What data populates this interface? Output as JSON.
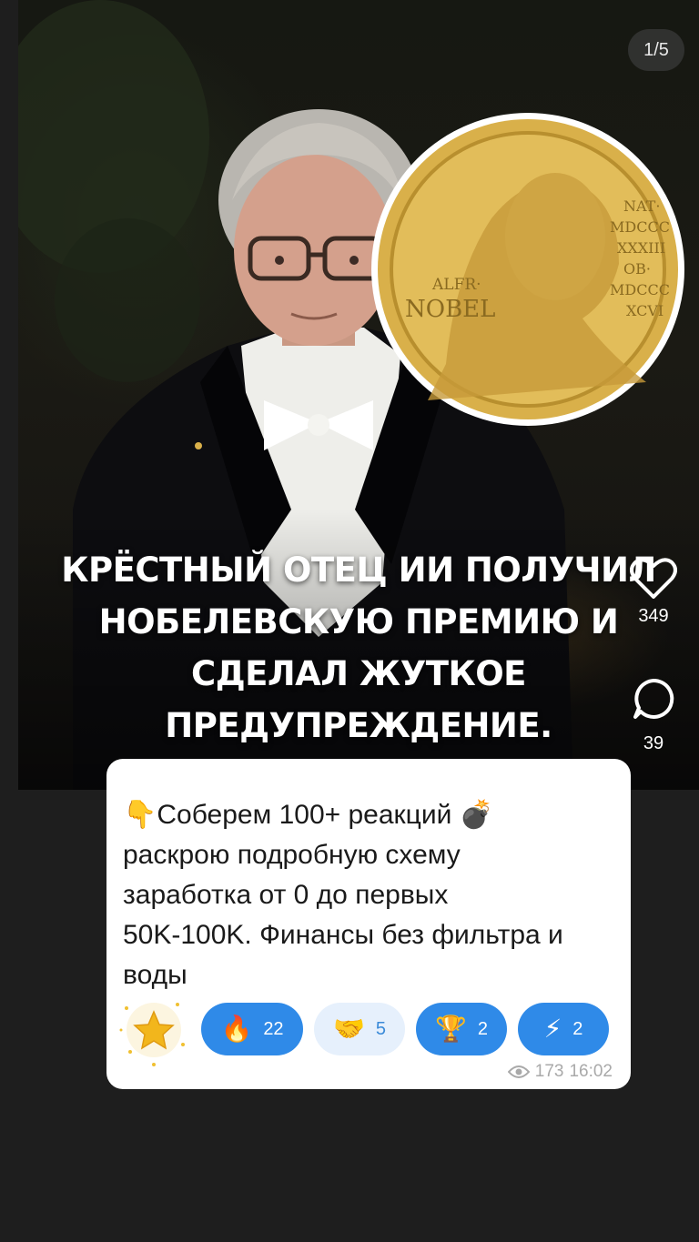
{
  "media": {
    "counter": "1/5",
    "headline_lines": [
      "КРЁСТНЫЙ ОТЕЦ ИИ ПОЛУЧИЛ",
      "НОБЕЛЕВСКУЮ ПРЕМИЮ И",
      "СДЕЛАЛ ЖУТКОЕ",
      "ПРЕДУПРЕЖДЕНИЕ."
    ],
    "medal_text": {
      "left_small": "ALFR·",
      "left_big": "NOBEL",
      "right_lines": [
        "NAT·",
        "MDCCC",
        "XXXIII",
        "OB·",
        "MDCCC",
        "XCVI"
      ]
    },
    "colors": {
      "gold": "#d9b04a",
      "background": "#1e1e1e"
    }
  },
  "actions": {
    "like": {
      "icon": "heart-icon",
      "count": "349"
    },
    "comment": {
      "icon": "comment-icon",
      "count": "39"
    }
  },
  "message": {
    "emoji_start": "👇",
    "line1": "Соберем 100+ реакций",
    "emoji_bomb": "💣",
    "line2": "раскрою подробную схему",
    "line3": "заработка от 0 до первых",
    "line4": "50K-100K. Финансы без фильтра и",
    "line5": "воды"
  },
  "reactions": [
    {
      "icon": "fire-icon",
      "glyph": "🔥",
      "count": "22",
      "style": "blue"
    },
    {
      "icon": "handshake-icon",
      "glyph": "🤝",
      "count": "5",
      "style": "light"
    },
    {
      "icon": "trophy-icon",
      "glyph": "🏆",
      "count": "2",
      "style": "blue"
    },
    {
      "icon": "lightning-icon",
      "glyph": "⚡",
      "count": "2",
      "style": "blue"
    }
  ],
  "meta": {
    "views": "173",
    "time": "16:02"
  }
}
